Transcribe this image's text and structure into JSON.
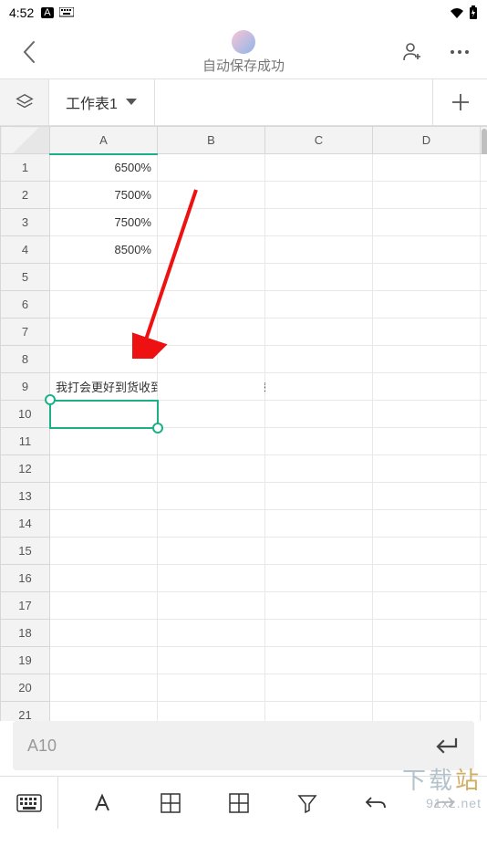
{
  "status": {
    "time": "4:52",
    "input_badge": "A",
    "keyboard_badge": "⌨"
  },
  "header": {
    "save_status": "自动保存成功"
  },
  "sheet_bar": {
    "active_sheet": "工作表1"
  },
  "columns": [
    "A",
    "B",
    "C",
    "D"
  ],
  "rows_count": 22,
  "cells": {
    "A1": "6500%",
    "A2": "7500%",
    "A3": "7500%",
    "A4": "8500%",
    "A9": "我打会更好到货收到符合红花岗股票广交会费"
  },
  "selection": {
    "cell": "A10",
    "row": 10,
    "col": "A"
  },
  "formula_bar": {
    "ref": "A10"
  },
  "watermark": {
    "line1_a": "下载",
    "line1_b": "站",
    "line2": "91xz.net"
  },
  "chart_data": {
    "type": "table",
    "columns": [
      "A",
      "B",
      "C",
      "D"
    ],
    "rows": [
      {
        "row": 1,
        "A": "6500%"
      },
      {
        "row": 2,
        "A": "7500%"
      },
      {
        "row": 3,
        "A": "7500%"
      },
      {
        "row": 4,
        "A": "8500%"
      },
      {
        "row": 9,
        "A": "我打会更好到货收到符合红花岗股票广交会费"
      }
    ],
    "selected_cell": "A10"
  }
}
